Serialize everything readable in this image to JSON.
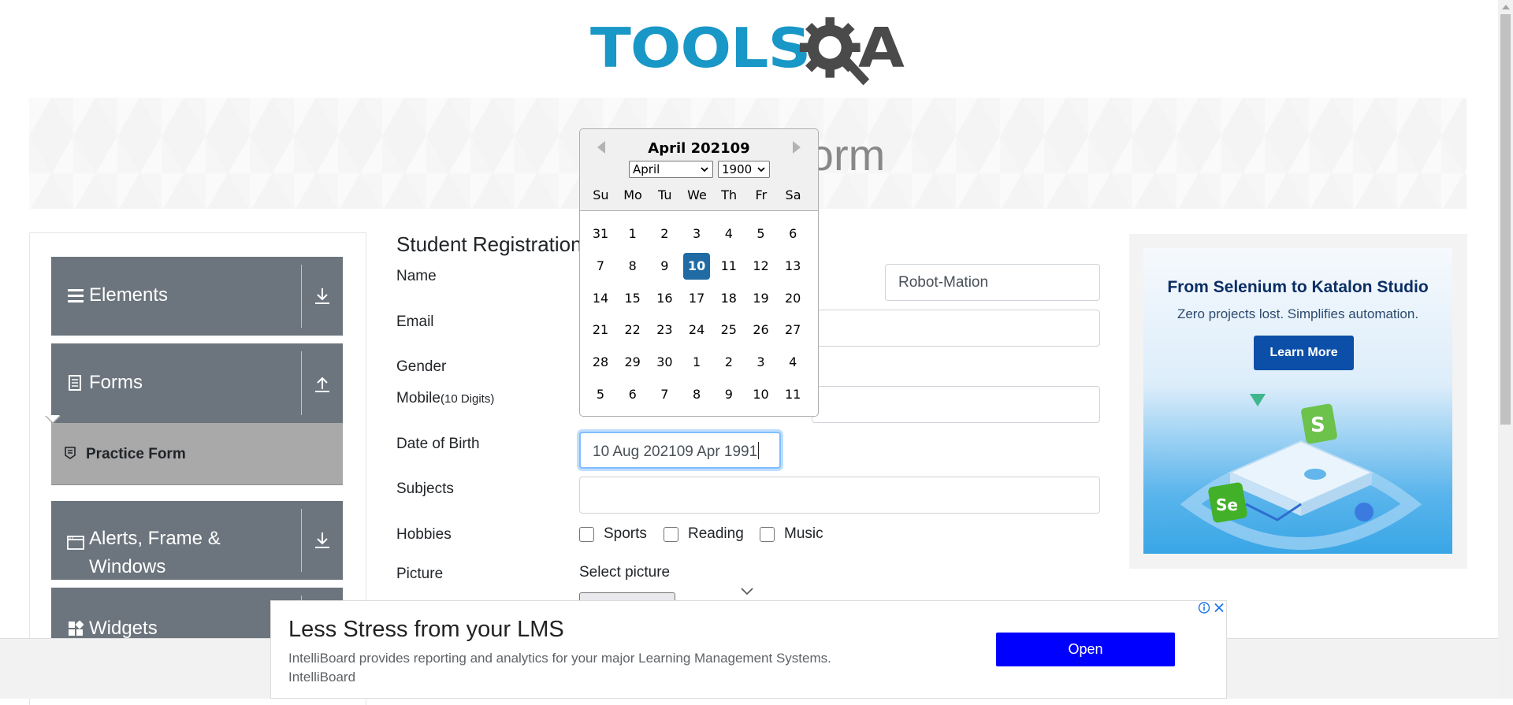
{
  "header": {
    "logo_text": "TOOLS",
    "logo_suffix": "QA"
  },
  "banner": {
    "title": "Practice Form"
  },
  "sidebar": {
    "groups": [
      {
        "label": "Elements",
        "icon": "hamburger-icon",
        "arrow": "download-arrow-icon"
      },
      {
        "label": "Forms",
        "icon": "document-icon",
        "arrow": "upload-arrow-icon"
      },
      {
        "label": "Alerts, Frame & Windows",
        "icon": "window-icon",
        "arrow": "download-arrow-icon"
      },
      {
        "label": "Widgets",
        "icon": "widgets-icon",
        "arrow": "download-arrow-icon"
      }
    ],
    "active_item": {
      "label": "Practice Form",
      "icon": "form-icon"
    }
  },
  "form": {
    "heading": "Student Registration Form",
    "labels": {
      "name": "Name",
      "email": "Email",
      "gender": "Gender",
      "mobile": "Mobile",
      "mobile_hint": "(10 Digits)",
      "dob": "Date of Birth",
      "subjects": "Subjects",
      "hobbies": "Hobbies",
      "picture": "Picture"
    },
    "name_last_value": "Robot-Mation",
    "dob_value": "10 Aug 202109 Apr 1991",
    "hobbies": [
      "Sports",
      "Reading",
      "Music"
    ],
    "select_picture": "Select picture"
  },
  "datepicker": {
    "title": "April 202109",
    "month_select": "April",
    "year_select": "1900",
    "day_names": [
      "Su",
      "Mo",
      "Tu",
      "We",
      "Th",
      "Fr",
      "Sa"
    ],
    "weeks": [
      [
        "31",
        "1",
        "2",
        "3",
        "4",
        "5",
        "6"
      ],
      [
        "7",
        "8",
        "9",
        "10",
        "11",
        "12",
        "13"
      ],
      [
        "14",
        "15",
        "16",
        "17",
        "18",
        "19",
        "20"
      ],
      [
        "21",
        "22",
        "23",
        "24",
        "25",
        "26",
        "27"
      ],
      [
        "28",
        "29",
        "30",
        "1",
        "2",
        "3",
        "4"
      ],
      [
        "5",
        "6",
        "7",
        "8",
        "9",
        "10",
        "11"
      ]
    ],
    "selected": "10"
  },
  "side_ad": {
    "title": "From Selenium to Katalon Studio",
    "subtitle": "Zero projects lost. Simplifies automation.",
    "button": "Learn More",
    "colors": {
      "brand": "#0b4fa8",
      "dark": "#0b2e63"
    }
  },
  "bottom_ad": {
    "title": "Less Stress from your LMS",
    "text": "IntelliBoard provides reporting and analytics for your major Learning Management Systems.",
    "advertiser": "IntelliBoard",
    "button": "Open"
  },
  "colors": {
    "logo_blue": "#1997c6",
    "logo_dark": "#4a4a4a",
    "sidebar_bg": "#6c757d",
    "selected_day": "#216ba5",
    "open_button": "#0000ff"
  }
}
